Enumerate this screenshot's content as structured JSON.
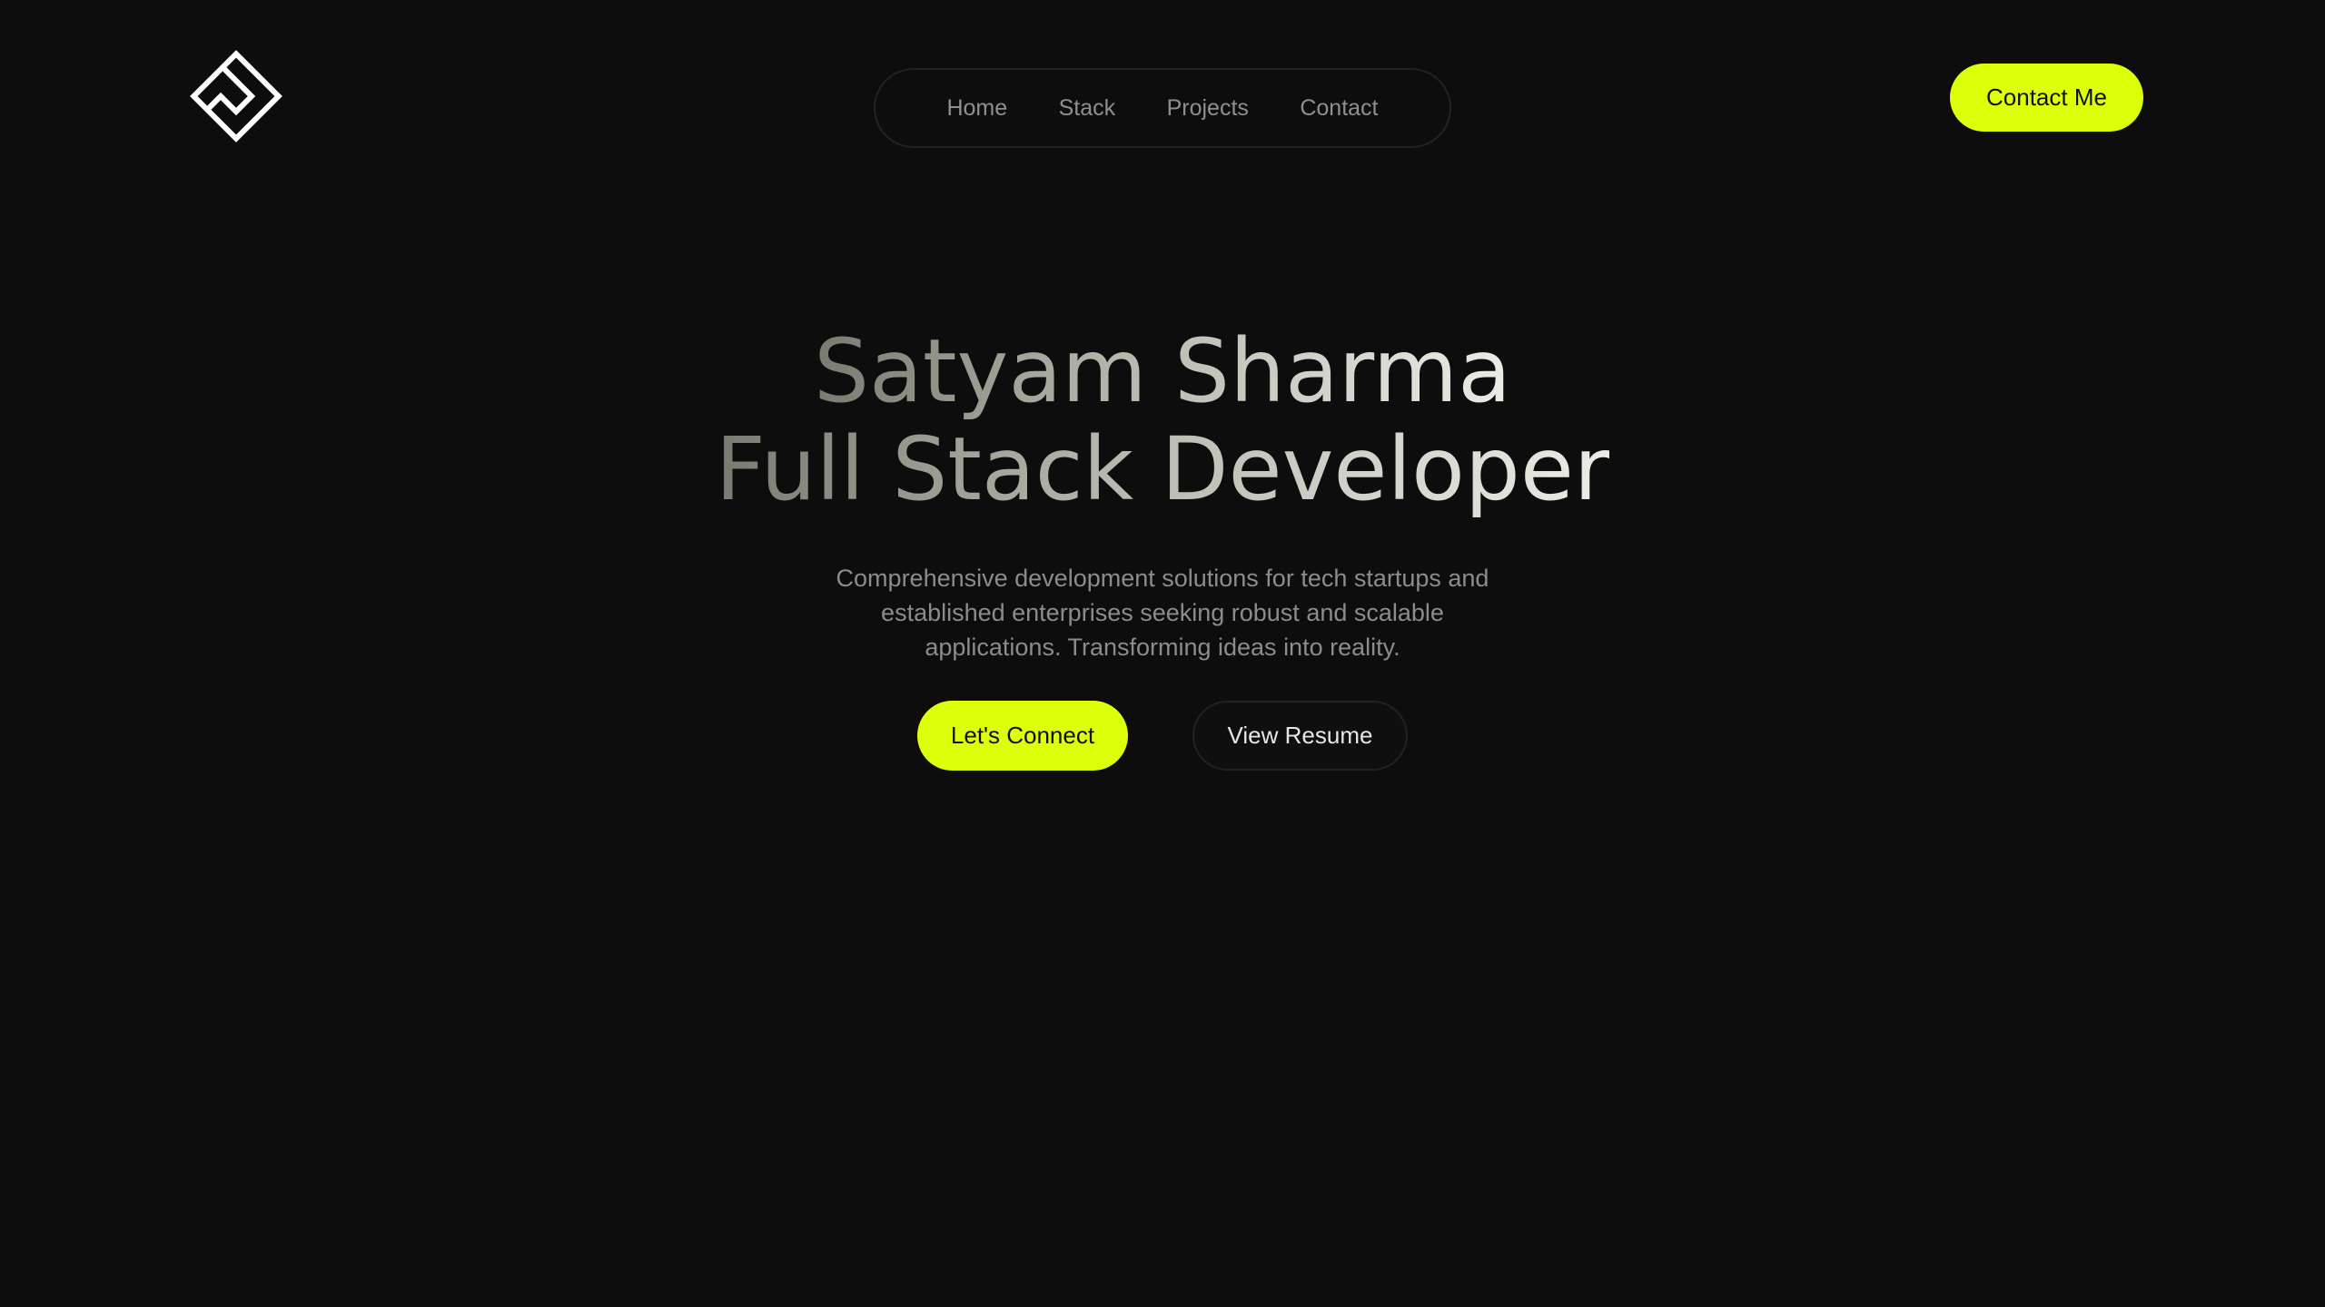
{
  "colors": {
    "background": "#0d0d0d",
    "accent": "#dcff0a",
    "nav_text": "#8f8f8f",
    "body_text": "#8c8c8c"
  },
  "header": {
    "logo_icon": "diamond-s-logo-icon",
    "nav": {
      "items": [
        {
          "label": "Home"
        },
        {
          "label": "Stack"
        },
        {
          "label": "Projects"
        },
        {
          "label": "Contact"
        }
      ]
    },
    "contact_button": "Contact Me"
  },
  "hero": {
    "title_line1": "Satyam Sharma",
    "title_line2": "Full Stack Developer",
    "description": "Comprehensive development solutions for tech startups and established enterprises seeking robust and scalable applications. Transforming ideas into reality.",
    "primary_button": "Let's Connect",
    "secondary_button": "View Resume"
  }
}
